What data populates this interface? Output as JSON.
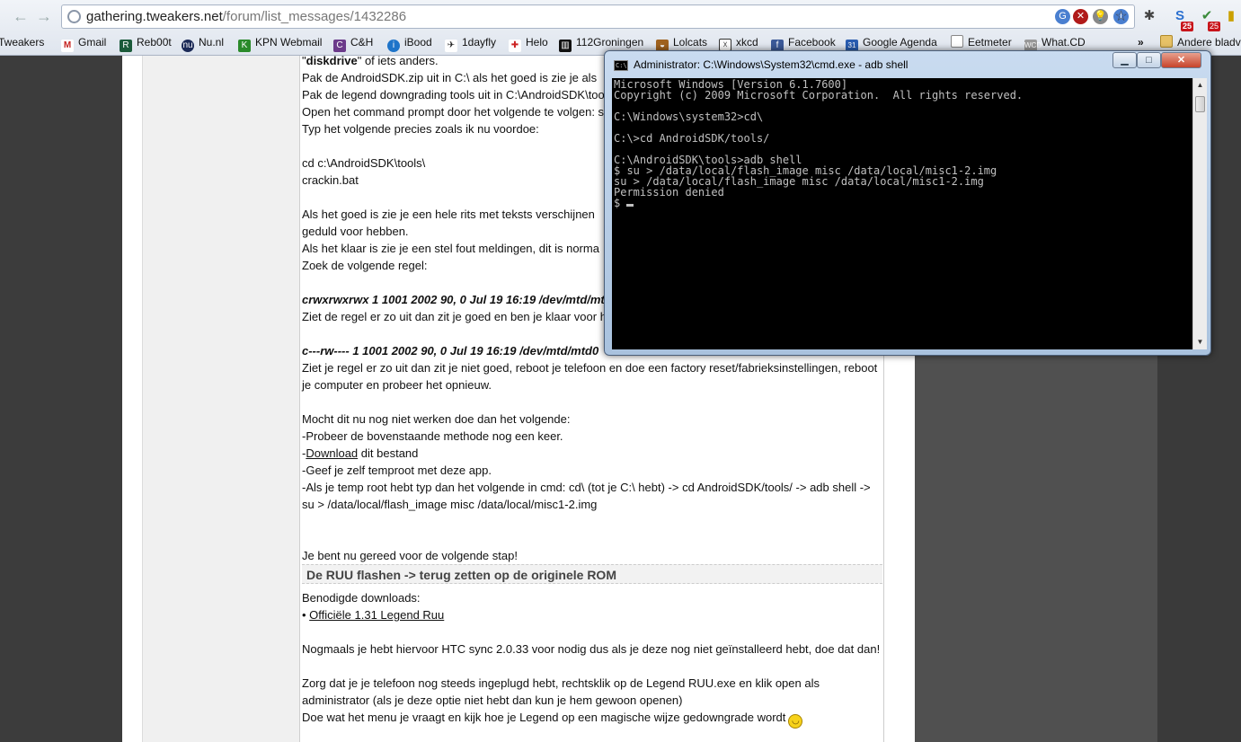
{
  "browser": {
    "url_host": "gathering.tweakers.net",
    "url_path": "/forum/list_messages/1432286",
    "bookmarks": [
      {
        "label": "Tweakers",
        "icon": "tweakers-icon",
        "color": "#2b6fb5"
      },
      {
        "label": "Gmail",
        "icon": "gmail-icon",
        "color": "#c5221f"
      },
      {
        "label": "Reb00t",
        "icon": "reboot-icon",
        "color": "#1a5a3a"
      },
      {
        "label": "Nu.nl",
        "icon": "nunl-icon",
        "color": "#1b2a57"
      },
      {
        "label": "KPN Webmail",
        "icon": "kpn-icon",
        "color": "#2a8a2a"
      },
      {
        "label": "C&H",
        "icon": "ch-icon",
        "color": "#6b3a8a"
      },
      {
        "label": "iBood",
        "icon": "ibood-icon",
        "color": "#1e74c9"
      },
      {
        "label": "1dayfly",
        "icon": "1dayfly-icon",
        "color": "#222222"
      },
      {
        "label": "Helo",
        "icon": "helo-icon",
        "color": "#cc2222"
      },
      {
        "label": "112Groningen",
        "icon": "112groningen-icon",
        "color": "#111111"
      },
      {
        "label": "Lolcats",
        "icon": "lolcats-icon",
        "color": "#a0621e"
      },
      {
        "label": "xkcd",
        "icon": "xkcd-icon",
        "color": "#333333"
      },
      {
        "label": "Facebook",
        "icon": "facebook-icon",
        "color": "#3b5998"
      },
      {
        "label": "Google Agenda",
        "icon": "google-agenda-icon",
        "color": "#2a5db0"
      },
      {
        "label": "Eetmeter",
        "icon": "page-icon",
        "color": "#888888"
      },
      {
        "label": "What.CD",
        "icon": "whatcd-icon",
        "color": "#777777"
      }
    ],
    "other_bookmarks": "Andere bladv",
    "overflow": "»",
    "badge_1": "25",
    "badge_2": "25"
  },
  "post": {
    "line_01_bold": "diskdrive",
    "line_01_rest": " of iets anders.",
    "line_02": "Pak de AndroidSDK.zip uit in C:\\ als het goed is zie je als",
    "line_03": "Pak de legend downgrading tools uit in C:\\AndroidSDK\\too",
    "line_04": "Open het command prompt door het volgende te volgen: st",
    "line_05": "Typ het volgende precies zoals ik nu voordoe:",
    "line_06": "cd c:\\AndroidSDK\\tools\\",
    "line_07": "crackin.bat",
    "line_08": "Als het goed is zie je een hele rits met teksts verschijnen",
    "line_09": "geduld voor hebben.",
    "line_10": "Als het klaar is zie je een stel fout meldingen, dit is norma",
    "line_11": "Zoek de volgende regel:",
    "line_12": "crwxrwxrwx 1 1001 2002 90, 0 Jul 19 16:19 /dev/mtd/mt",
    "line_13": "Ziet de regel er zo uit dan zit je goed en ben je klaar voor h",
    "line_14": "c---rw---- 1 1001 2002 90, 0 Jul 19 16:19 /dev/mtd/mtd0",
    "line_15": "Ziet je regel er zo uit dan zit je niet goed, reboot je telefoon en doe een factory reset/fabrieksinstellingen, reboot",
    "line_16": "je computer en probeer het opnieuw.",
    "line_17": "Mocht dit nu nog niet werken doe dan het volgende:",
    "line_18": "-Probeer de bovenstaande methode nog een keer.",
    "line_19_prefix": "-",
    "line_19_link": "Download",
    "line_19_rest": " dit bestand",
    "line_20": "-Geef je zelf temproot met deze app.",
    "line_21": "-Als je temp root hebt typ dan het volgende in cmd: cd\\ (tot je C:\\ hebt) -> cd AndroidSDK/tools/ -> adb shell ->",
    "line_22": "su > /data/local/flash_image misc /data/local/misc1-2.img",
    "line_23": "Je bent nu gereed voor de volgende stap!",
    "heading": "De RUU flashen -> terug zetten op de originele ROM",
    "line_24": "Benodigde downloads:",
    "line_25_bullet": "• ",
    "line_25_link": "Officiële 1.31 Legend Ruu",
    "line_26": "Nogmaals je hebt hiervoor HTC sync 2.0.33 voor nodig dus als je deze nog niet geïnstalleerd hebt, doe dat dan!",
    "line_27": "Zorg dat je je telefoon nog steeds ingeplugd hebt, rechtsklik op de Legend RUU.exe en klik open als",
    "line_28": "administrator (als je deze optie niet hebt dan kun je hem gewoon openen)",
    "line_29": "Doe wat het menu je vraagt en kijk hoe je Legend op een magische wijze gedowngrade wordt"
  },
  "cmd": {
    "title": "Administrator: C:\\Windows\\System32\\cmd.exe - adb  shell",
    "icon_text": "C:\\",
    "btn_min": "▁",
    "btn_max": "□",
    "btn_close": "✕",
    "output": "Microsoft Windows [Version 6.1.7600]\nCopyright (c) 2009 Microsoft Corporation.  All rights reserved.\n\nC:\\Windows\\system32>cd\\\n\nC:\\>cd AndroidSDK/tools/\n\nC:\\AndroidSDK\\tools>adb shell\n$ su > /data/local/flash_image misc /data/local/misc1-2.img\nsu > /data/local/flash_image misc /data/local/misc1-2.img\nPermission denied\n$ "
  }
}
